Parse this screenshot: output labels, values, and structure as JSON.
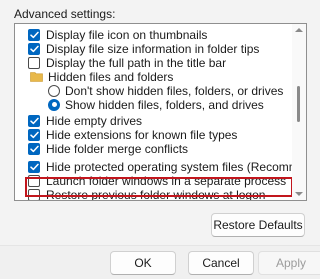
{
  "section_label": "Advanced settings:",
  "tree_items": [
    {
      "type": "checkbox",
      "checked": true,
      "label": "Display file icon on thumbnails"
    },
    {
      "type": "checkbox",
      "checked": true,
      "label": "Display file size information in folder tips"
    },
    {
      "type": "checkbox",
      "checked": false,
      "label": "Display the full path in the title bar"
    },
    {
      "type": "folder",
      "label": "Hidden files and folders"
    },
    {
      "type": "radio",
      "checked": false,
      "label": "Don't show hidden files, folders, or drives"
    },
    {
      "type": "radio",
      "checked": true,
      "label": "Show hidden files, folders, and drives"
    },
    {
      "type": "checkbox",
      "checked": true,
      "label": "Hide empty drives"
    },
    {
      "type": "checkbox",
      "checked": true,
      "label": "Hide extensions for known file types"
    },
    {
      "type": "checkbox",
      "checked": true,
      "label": "Hide folder merge conflicts"
    },
    {
      "type": "checkbox",
      "checked": true,
      "label": "Hide protected operating system files (Recommended)",
      "highlighted": true
    },
    {
      "type": "checkbox",
      "checked": false,
      "label": "Launch folder windows in a separate process"
    },
    {
      "type": "checkbox",
      "checked": false,
      "label": "Restore previous folder windows at logon"
    }
  ],
  "buttons": {
    "restore_defaults": "Restore Defaults",
    "ok": "OK",
    "cancel": "Cancel",
    "apply": "Apply"
  },
  "colors": {
    "accent": "#0067c0",
    "highlight_border": "#c2161d",
    "folder": "#e8b84a"
  }
}
